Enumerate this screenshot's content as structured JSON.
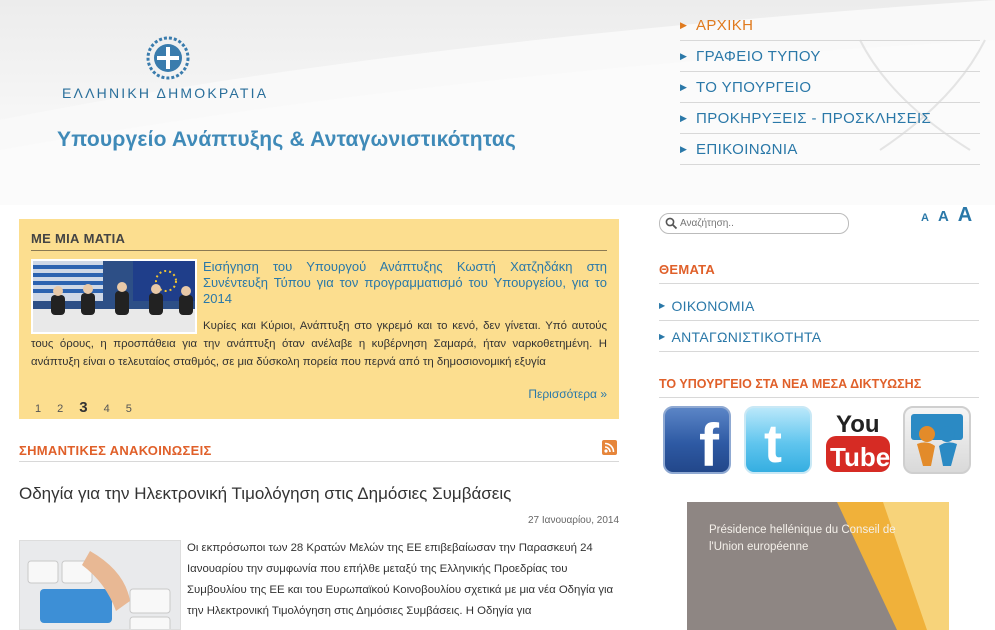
{
  "header": {
    "republic": "ΕΛΛΗΝΙΚΗ ΔΗΜΟΚΡΑΤΙΑ",
    "ministry": "Υπουργείο Ανάπτυξης & Ανταγωνιστικότητας"
  },
  "topnav": {
    "items": [
      {
        "label": "ΑΡΧΙΚΗ"
      },
      {
        "label": "ΓΡΑΦΕΙΟ ΤΥΠΟΥ"
      },
      {
        "label": "ΤΟ ΥΠΟΥΡΓΕΙΟ"
      },
      {
        "label": "ΠΡΟΚΗΡΥΞΕΙΣ - ΠΡΟΣΚΛΗΣΕΙΣ"
      },
      {
        "label": "ΕΠΙΚΟΙΝΩΝΙΑ"
      }
    ],
    "active_color": "#e07a1e",
    "link_color": "#2a78a8"
  },
  "glance": {
    "title": "ΜΕ ΜΙΑ ΜΑΤΙΑ",
    "headline": "Εισήγηση του Υπουργού Ανάπτυξης Κωστή Χατζηδάκη στη Συνέντευξη Τύπου για τον προγραμματισμό του Υπουργείου, για το 2014",
    "body": "Κυρίες και Κύριοι,  Ανάπτυξη στο γκρεμό και το κενό, δεν γίνεται.  Υπό αυτούς τους όρους, η προσπάθεια για την ανάπτυξη όταν ανέλαβε η κυβέρνηση Σαμαρά, ήταν ναρκοθετημένη.  Η ανάπτυξη είναι ο τελευταίος σταθμός, σε μια δύσκολη πορεία που περνά από τη δημοσιονομική εξυγία",
    "more": "Περισσότερα »",
    "pages": [
      "1",
      "2",
      "3",
      "4",
      "5"
    ],
    "background": "#fcde8f"
  },
  "announcements": {
    "title": "ΣΗΜΑΝΤΙΚΕΣ ΑΝΑΚΟΙΝΩΣΕΙΣ",
    "article": {
      "title": "Οδηγία για την Ηλεκτρονική Τιμολόγηση στις Δημόσιες Συμβάσεις",
      "date": "27 Ιανουαρίου, 2014",
      "text": "Οι εκπρόσωποι των 28 Κρατών Μελών της ΕΕ επιβεβαίωσαν την Παρασκευή 24 Ιανουαρίου την συμφωνία που επήλθε μεταξύ της Ελληνικής Προεδρίας του Συμβουλίου της ΕΕ και του Ευρωπαϊκού Κοινοβουλίου σχετικά με μια νέα Οδηγία για την Ηλεκτρονική Τιμολόγηση στις Δημόσιες Συμβάσεις. Η Οδηγία για"
    }
  },
  "sidebar": {
    "search_placeholder": "Αναζήτηση..",
    "font_sizes": [
      "A",
      "A",
      "A"
    ],
    "themes_title": "ΘΕΜΑΤΑ",
    "themes": [
      {
        "label": "ΟΙΚΟΝΟΜΙΑ"
      },
      {
        "label": "ΑΝΤΑΓΩΝΙΣΤΙΚΟΤΗΤΑ"
      }
    ],
    "social_title": "ΤΟ ΥΠΟΥΡΓΕΙΟ ΣΤΑ ΝΕΑ ΜΕΣΑ ΔΙΚΤΥΩΣΗΣ",
    "social": [
      {
        "name": "facebook-icon",
        "glyph": "f"
      },
      {
        "name": "twitter-icon",
        "glyph": "t"
      },
      {
        "name": "youtube-icon",
        "glyph_top": "You",
        "glyph_bottom": "Tube"
      },
      {
        "name": "slideshare-icon"
      }
    ],
    "presidency": "Présidence hellénique du Conseil de l'Union européenne"
  }
}
